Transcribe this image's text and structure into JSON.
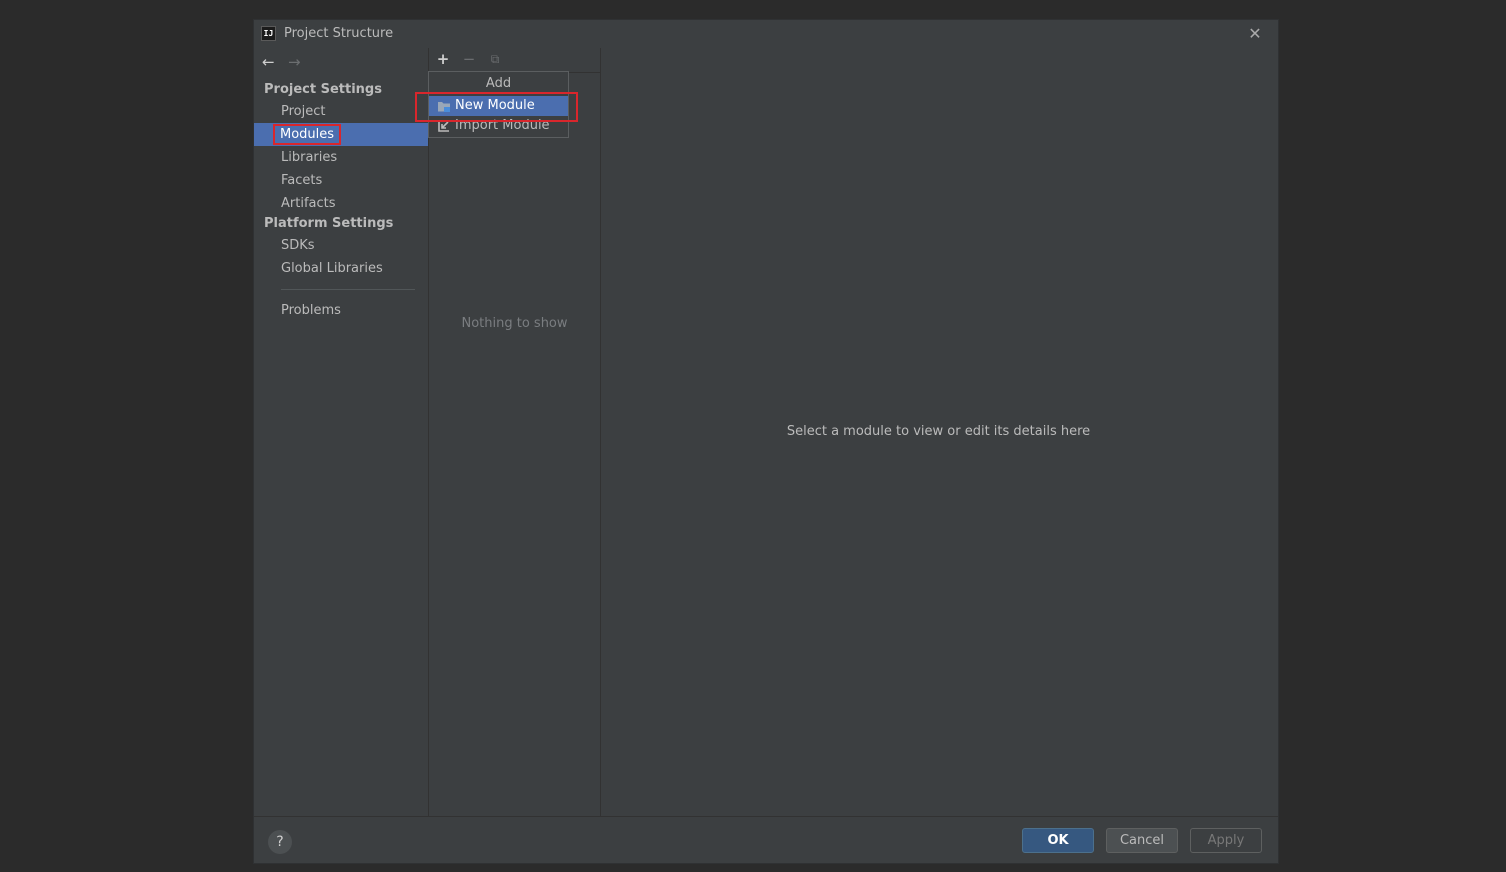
{
  "window": {
    "title": "Project Structure"
  },
  "sidebar": {
    "project_settings_header": "Project Settings",
    "project_items": [
      "Project",
      "Modules",
      "Libraries",
      "Facets",
      "Artifacts"
    ],
    "platform_settings_header": "Platform Settings",
    "platform_items": [
      "SDKs",
      "Global Libraries"
    ],
    "problems_label": "Problems",
    "selected": "Modules"
  },
  "modules_list": {
    "empty_text": "Nothing to show"
  },
  "add_popup": {
    "title": "Add",
    "items": [
      "New Module",
      "Import Module"
    ],
    "highlighted": "New Module"
  },
  "detail": {
    "placeholder": "Select a module to view or edit its details here"
  },
  "footer": {
    "help": "?",
    "ok": "OK",
    "cancel": "Cancel",
    "apply": "Apply"
  },
  "icons": {
    "app": "intellij-icon",
    "close": "close-icon",
    "back": "arrow-left-icon",
    "forward": "arrow-right-icon",
    "add": "plus-icon",
    "remove": "minus-icon",
    "copy": "copy-icon",
    "new_module": "folder-icon",
    "import_module": "import-icon"
  },
  "colors": {
    "selection": "#4b6eaf",
    "annotation": "#d9262c",
    "ok_button": "#365880"
  }
}
